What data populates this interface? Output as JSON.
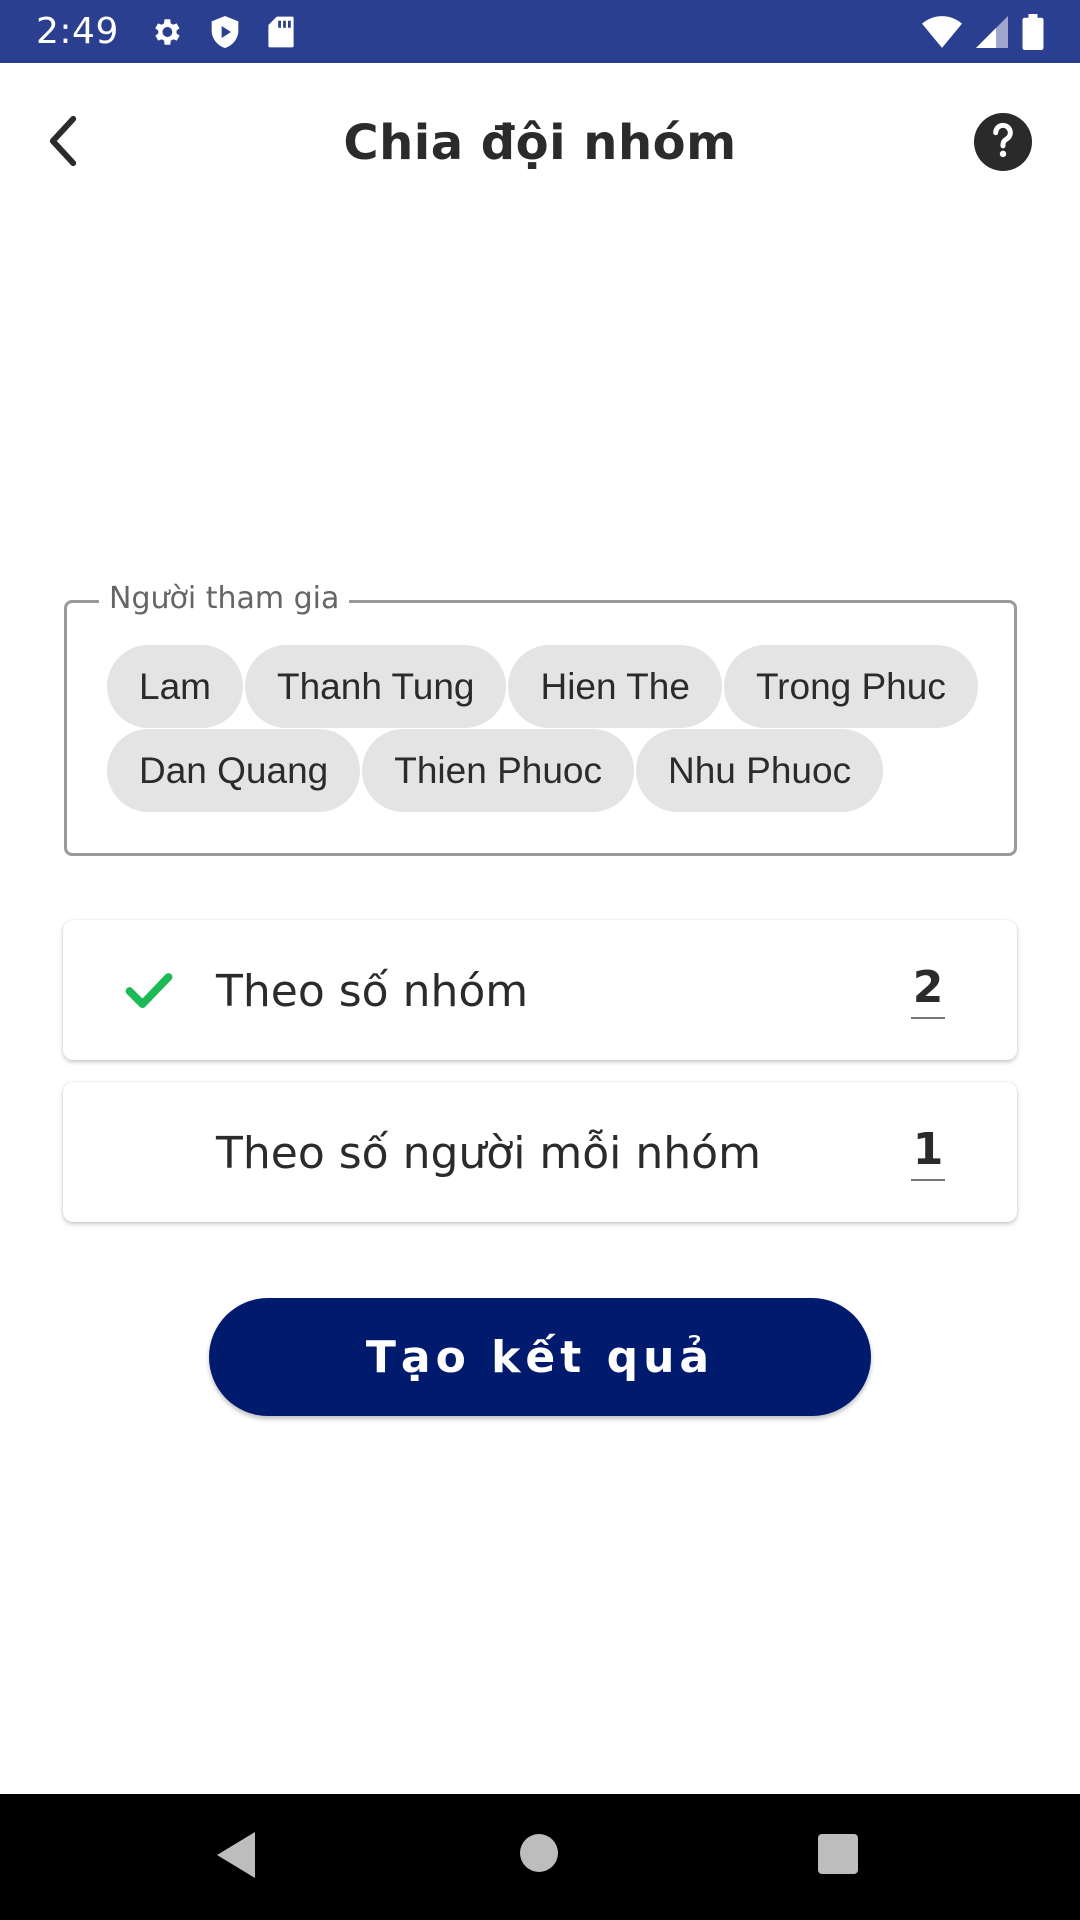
{
  "status_bar": {
    "time": "2:49",
    "icons_left": [
      "gear-icon",
      "shield-play-icon",
      "sd-card-icon"
    ],
    "icons_right": [
      "wifi-icon",
      "signal-icon",
      "battery-icon"
    ]
  },
  "app_bar": {
    "title": "Chia đội nhóm",
    "back_icon": "chevron-left-icon",
    "help_icon": "help-circle-icon"
  },
  "participants": {
    "legend": "Người tham gia",
    "names": [
      "Lam",
      "Thanh Tung",
      "Hien The",
      "Trong Phuc",
      "Dan Quang",
      "Thien Phuoc",
      "Nhu Phuoc"
    ]
  },
  "options": [
    {
      "label": "Theo số nhóm",
      "value": "2",
      "selected": true
    },
    {
      "label": "Theo số người mỗi nhóm",
      "value": "1",
      "selected": false
    }
  ],
  "generate_button": {
    "label": "Tạo kết quả"
  },
  "colors": {
    "status_bar": "#2a3f8f",
    "primary_button": "#001a6e",
    "check": "#1db954",
    "chip": "#e4e4e4"
  },
  "nav_bar": {
    "icons": [
      "nav-back-icon",
      "nav-home-icon",
      "nav-recents-icon"
    ]
  }
}
